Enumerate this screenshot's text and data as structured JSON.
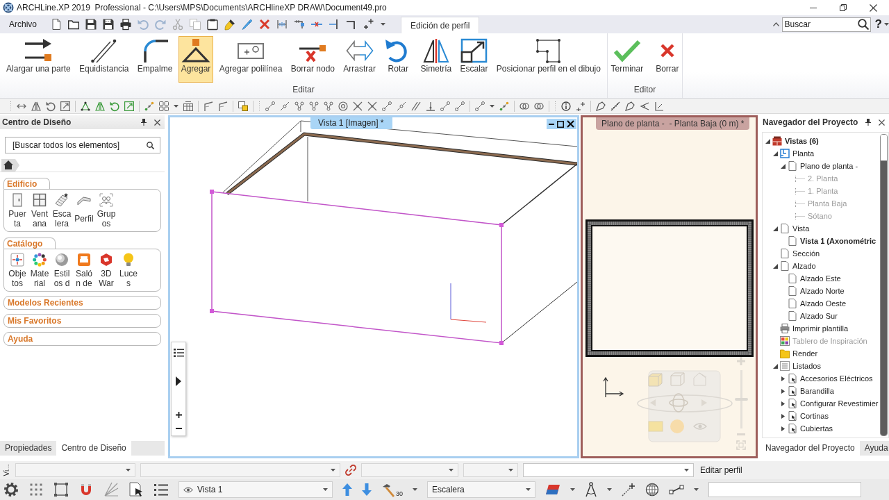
{
  "window": {
    "title": "ARCHLine.XP 2019  Professional - C:\\Users\\MPS\\Documents\\ARCHlineXP DRAW\\Document49.pro"
  },
  "menu_bar": {
    "file_menu": "Archivo",
    "tabs": [
      {
        "label": "Edición de perfil",
        "selected": true
      }
    ],
    "search": {
      "placeholder": "Buscar"
    },
    "help": "?"
  },
  "ribbon": {
    "groups": [
      {
        "label": "Editar",
        "buttons": [
          {
            "label": "Alargar una parte",
            "selected": false
          },
          {
            "label": "Equidistancia",
            "selected": false
          },
          {
            "label": "Empalme",
            "selected": false
          },
          {
            "label": "Agregar",
            "selected": true
          },
          {
            "label": "Agregar polilínea",
            "selected": false
          },
          {
            "label": "Borrar nodo",
            "selected": false
          },
          {
            "label": "Arrastrar",
            "selected": false
          },
          {
            "label": "Rotar",
            "selected": false
          },
          {
            "label": "Simetría",
            "selected": false
          },
          {
            "label": "Escalar",
            "selected": false
          },
          {
            "label": "Posicionar perfil en el dibujo",
            "selected": false
          }
        ]
      },
      {
        "label": "Editor",
        "buttons": [
          {
            "label": "Terminar",
            "selected": false
          },
          {
            "label": "Borrar",
            "selected": false
          }
        ]
      }
    ]
  },
  "design_center": {
    "title": "Centro de Diseño",
    "search": {
      "placeholder": "[Buscar todos los elementos]"
    },
    "sections": [
      {
        "label": "Edificio",
        "expanded": true,
        "items": [
          "Puerta",
          "Ventana",
          "Escalera",
          "Perfil",
          "Grupos"
        ]
      },
      {
        "label": "Catálogo",
        "expanded": true,
        "items": [
          "Objetos",
          "Material",
          "Estilos d",
          "Salón de",
          "3D War",
          "Luces"
        ]
      },
      {
        "label": "Modelos Recientes",
        "expanded": false
      },
      {
        "label": "Mis Favoritos",
        "expanded": false
      },
      {
        "label": "Ayuda",
        "expanded": false
      }
    ],
    "tabs": [
      {
        "label": "Propiedades",
        "selected": false
      },
      {
        "label": "Centro de Diseño",
        "selected": true
      }
    ]
  },
  "viewport_3d": {
    "title": "Vista 1 [Imagen] *"
  },
  "plan_view": {
    "title": "Plano de planta -  - Planta Baja (0 m) *",
    "zoom_slider": {
      "level": 0.5
    }
  },
  "project_navigator": {
    "title": "Navegador del Proyecto",
    "tree": [
      {
        "label": "Vistas (6)",
        "kind": "views",
        "expanded": true,
        "current": true,
        "dimmed": false,
        "children": [
          {
            "label": "Planta",
            "kind": "plan",
            "expanded": true,
            "current": false,
            "dimmed": false,
            "children": [
              {
                "label": "Plano de planta -",
                "kind": "page",
                "expanded": true,
                "current": false,
                "dimmed": false,
                "children": [
                  {
                    "label": "2. Planta",
                    "kind": "level",
                    "current": false,
                    "dimmed": true
                  },
                  {
                    "label": "1. Planta",
                    "kind": "level",
                    "current": false,
                    "dimmed": true
                  },
                  {
                    "label": "Planta Baja",
                    "kind": "level",
                    "current": false,
                    "dimmed": true
                  },
                  {
                    "label": "Sótano",
                    "kind": "level",
                    "current": false,
                    "dimmed": true
                  }
                ]
              }
            ]
          },
          {
            "label": "Vista",
            "kind": "page",
            "expanded": true,
            "current": false,
            "dimmed": false,
            "children": [
              {
                "label": "Vista 1 (Axonométric",
                "kind": "page",
                "current": true,
                "dimmed": false
              }
            ]
          },
          {
            "label": "Sección",
            "kind": "page",
            "current": false,
            "dimmed": false
          },
          {
            "label": "Alzado",
            "kind": "page",
            "expanded": true,
            "current": false,
            "dimmed": false,
            "children": [
              {
                "label": "Alzado Este",
                "kind": "page",
                "current": false,
                "dimmed": false
              },
              {
                "label": "Alzado Norte",
                "kind": "page",
                "current": false,
                "dimmed": false
              },
              {
                "label": "Alzado Oeste",
                "kind": "page",
                "current": false,
                "dimmed": false
              },
              {
                "label": "Alzado Sur",
                "kind": "page",
                "current": false,
                "dimmed": false
              }
            ]
          },
          {
            "label": "Imprimir plantilla",
            "kind": "printer",
            "current": false,
            "dimmed": false
          },
          {
            "label": "Tablero de Inspiración",
            "kind": "board",
            "current": false,
            "dimmed": true
          },
          {
            "label": "Render",
            "kind": "folder",
            "current": false,
            "dimmed": false
          },
          {
            "label": "Listados",
            "kind": "list",
            "expanded": true,
            "current": false,
            "dimmed": false,
            "children": [
              {
                "label": "Accesorios Eléctricos",
                "kind": "report",
                "expanded": false,
                "current": false,
                "dimmed": false
              },
              {
                "label": "Barandilla",
                "kind": "report",
                "expanded": false,
                "current": false,
                "dimmed": false
              },
              {
                "label": "Configurar Revestimier",
                "kind": "report",
                "expanded": false,
                "current": false,
                "dimmed": false
              },
              {
                "label": "Cortinas",
                "kind": "report",
                "expanded": false,
                "current": false,
                "dimmed": false
              },
              {
                "label": "Cubiertas",
                "kind": "report",
                "expanded": false,
                "current": false,
                "dimmed": false
              }
            ]
          }
        ]
      }
    ],
    "tabs": [
      {
        "label": "Navegador del Proyecto",
        "selected": true
      },
      {
        "label": "Ayuda",
        "selected": false
      }
    ]
  },
  "status_bar": {
    "panel_label": "Vi...",
    "prompt": "Editar perfil",
    "view_select": "Vista 1",
    "hammer_label": "30",
    "element_select": "Escalera"
  }
}
